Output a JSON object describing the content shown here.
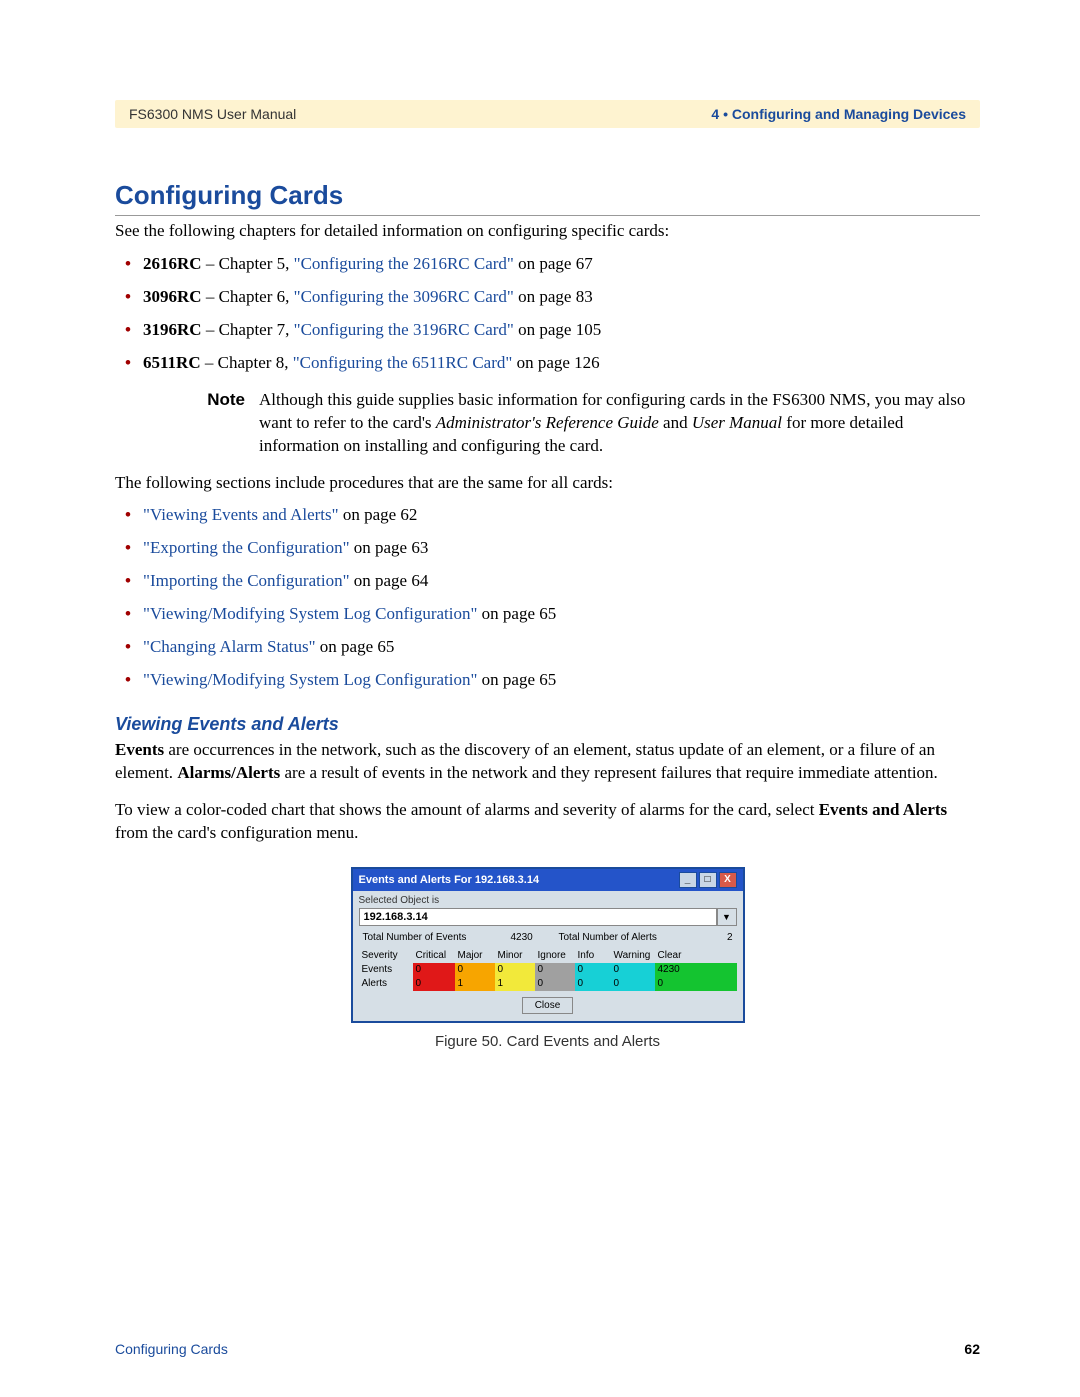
{
  "header": {
    "left": "FS6300 NMS User Manual",
    "right": "4 • Configuring and Managing Devices"
  },
  "h1": "Configuring Cards",
  "intro": "See the following chapters for detailed information on configuring specific cards:",
  "cards": [
    {
      "name": "2616RC",
      "pre": " – Chapter 5, ",
      "link": "\"Configuring the 2616RC Card\"",
      "post": " on page 67"
    },
    {
      "name": "3096RC",
      "pre": " – Chapter 6, ",
      "link": "\"Configuring the 3096RC Card\"",
      "post": " on page 83"
    },
    {
      "name": "3196RC",
      "pre": " – Chapter 7, ",
      "link": "\"Configuring the 3196RC Card\"",
      "post": " on page 105"
    },
    {
      "name": "6511RC",
      "pre": " – Chapter 8, ",
      "link": "\"Configuring the 6511RC Card\"",
      "post": " on page 126"
    }
  ],
  "note": {
    "label": "Note",
    "t1": "Although this guide supplies basic information for configuring cards in the FS6300 NMS, you may also want to refer to the card's ",
    "i1": "Administrator's Reference Guide",
    "t2": " and ",
    "i2": "User Manual",
    "t3": " for more detailed information on installing and configuring the card."
  },
  "procedures_intro": "The following sections include procedures that are the same for all cards:",
  "procedures": [
    {
      "link": "\"Viewing Events and Alerts\"",
      "post": " on page 62"
    },
    {
      "link": "\"Exporting the Configuration\"",
      "post": " on page 63"
    },
    {
      "link": "\"Importing the Configuration\"",
      "post": " on page 64"
    },
    {
      "link": "\"Viewing/Modifying System Log Configuration\"",
      "post": " on page 65"
    },
    {
      "link": "\"Changing Alarm Status\"",
      "post": " on page 65"
    },
    {
      "link": "\"Viewing/Modifying System Log Configuration\"",
      "post": " on page 65"
    }
  ],
  "h2": "Viewing Events and Alerts",
  "para1": {
    "b1": "Events",
    "t1": " are occurrences in the network, such as the discovery of an element, status update of an element, or a filure of an element. ",
    "b2": "Alarms/Alerts",
    "t2": " are a result of events in the network and they represent failures that require immediate attention."
  },
  "para2": {
    "t1": "To view a color-coded chart that shows the amount of alarms and severity of alarms for the card, select ",
    "b1": "Events and Alerts",
    "t2": " from the card's configuration menu."
  },
  "window": {
    "title": "Events and Alerts For 192.168.3.14",
    "min": "_",
    "max": "□",
    "close": "X",
    "selected_label": "Selected Object is",
    "ip": "192.168.3.14",
    "dropdown_glyph": "▼",
    "total_events_label": "Total Number of Events",
    "total_events": "4230",
    "total_alerts_label": "Total Number of Alerts",
    "total_alerts": "2",
    "headers": {
      "severity": "Severity",
      "critical": "Critical",
      "major": "Major",
      "minor": "Minor",
      "ignore": "Ignore",
      "info": "Info",
      "warning": "Warning",
      "clear": "Clear"
    },
    "events": {
      "label": "Events",
      "critical": "0",
      "major": "0",
      "minor": "0",
      "ignore": "0",
      "info": "0",
      "warning": "0",
      "clear": "4230"
    },
    "alerts": {
      "label": "Alerts",
      "critical": "0",
      "major": "1",
      "minor": "1",
      "ignore": "0",
      "info": "0",
      "warning": "0",
      "clear": "0"
    },
    "close_btn": "Close"
  },
  "figure_caption": "Figure 50. Card Events and Alerts",
  "footer": {
    "left": "Configuring Cards",
    "right": "62"
  }
}
